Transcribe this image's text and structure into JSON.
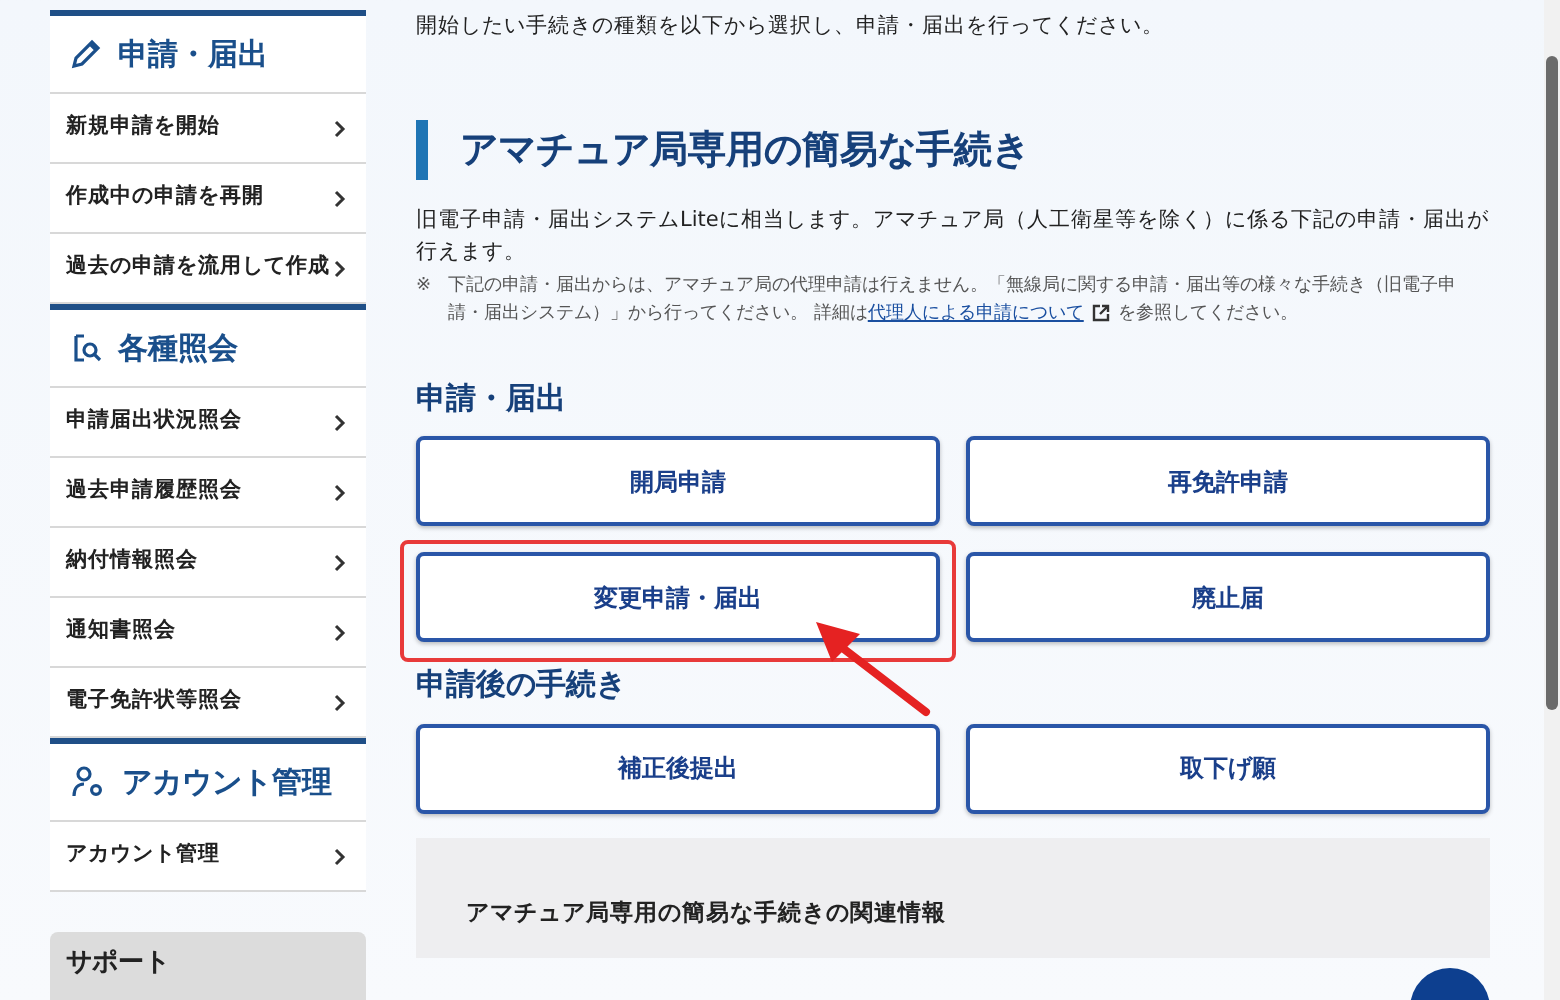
{
  "sidebar": {
    "sections": [
      {
        "title": "申請・届出",
        "items": [
          "新規申請を開始",
          "作成中の申請を再開",
          "過去の申請を流用して作成"
        ]
      },
      {
        "title": "各種照会",
        "items": [
          "申請届出状況照会",
          "過去申請履歴照会",
          "納付情報照会",
          "通知書照会",
          "電子免許状等照会"
        ]
      },
      {
        "title": "アカウント管理",
        "items": [
          "アカウント管理"
        ]
      }
    ],
    "support_title": "サポート"
  },
  "intro": "開始したい手続きの種類を以下から選択し、申請・届出を行ってください。",
  "heading": "アマチュア局専用の簡易な手続き",
  "description": "旧電子申請・届出システムLiteに相当します。アマチュア局（人工衛星等を除く）に係る下記の申請・届出が行えます。",
  "note": {
    "mark": "※",
    "before": "下記の申請・届出からは、アマチュア局の代理申請は行えません。「無線局に関する申請・届出等の様々な手続き（旧電子申請・届出システム）」から行ってください。 詳細は",
    "link": "代理人による申請について",
    "after": "を参照してください。"
  },
  "groups": [
    {
      "title": "申請・届出",
      "buttons": [
        {
          "label": "開局申請",
          "highlighted": false
        },
        {
          "label": "再免許申請",
          "highlighted": false
        },
        {
          "label": "変更申請・届出",
          "highlighted": true
        },
        {
          "label": "廃止届",
          "highlighted": false
        }
      ]
    },
    {
      "title": "申請後の手続き",
      "buttons": [
        {
          "label": "補正後提出",
          "highlighted": false
        },
        {
          "label": "取下げ願",
          "highlighted": false
        }
      ]
    }
  ],
  "related_title": "アマチュア局専用の簡易な手続きの関連情報"
}
